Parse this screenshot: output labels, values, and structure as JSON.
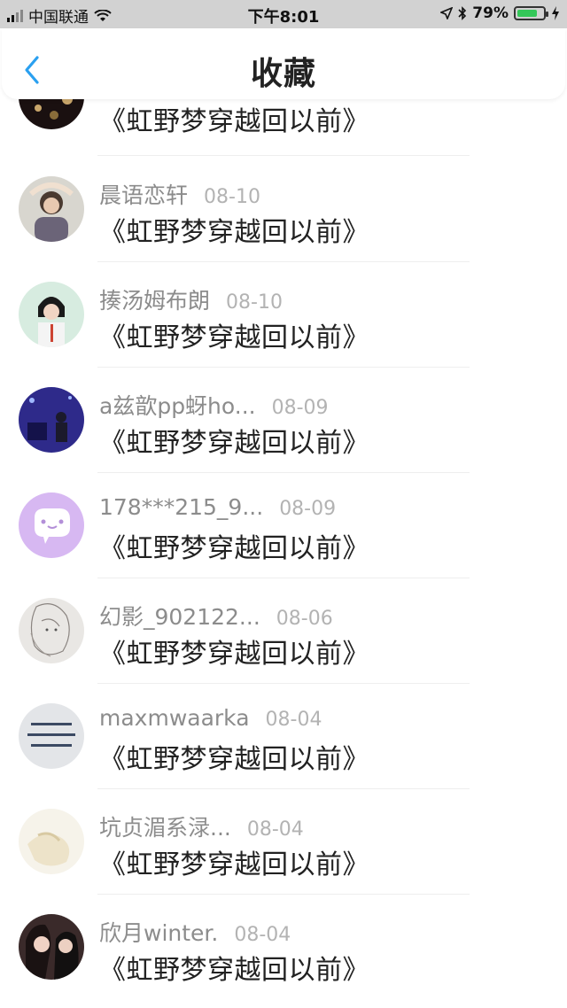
{
  "status_bar": {
    "carrier": "中国联通",
    "time": "下午8:01",
    "battery_percent": "79%",
    "battery_level": 0.79,
    "battery_color": "#34c759",
    "icons": [
      "signal-icon",
      "wifi-icon",
      "location-icon",
      "bluetooth-icon",
      "battery-icon",
      "charging-icon"
    ]
  },
  "nav": {
    "title": "收藏",
    "back_icon": "chevron-left-icon",
    "accent": "#2aa0f0"
  },
  "items": [
    {
      "username": "",
      "date": "",
      "title": "《虹野梦穿越回以前》"
    },
    {
      "username": "晨语恋轩",
      "date": "08-10",
      "title": "《虹野梦穿越回以前》"
    },
    {
      "username": "揍汤姆布朗",
      "date": "08-10",
      "title": "《虹野梦穿越回以前》"
    },
    {
      "username": "a兹歆pp蚜ho...",
      "date": "08-09",
      "title": "《虹野梦穿越回以前》"
    },
    {
      "username": "178***215_9...",
      "date": "08-09",
      "title": "《虹野梦穿越回以前》"
    },
    {
      "username": "幻影_902122...",
      "date": "08-06",
      "title": "《虹野梦穿越回以前》"
    },
    {
      "username": "maxmwaarka",
      "date": "08-04",
      "title": "《虹野梦穿越回以前》"
    },
    {
      "username": "坑贞湄系渌...",
      "date": "08-04",
      "title": "《虹野梦穿越回以前》"
    },
    {
      "username": "欣月winter.",
      "date": "08-04",
      "title": "《虹野梦穿越回以前》"
    }
  ]
}
